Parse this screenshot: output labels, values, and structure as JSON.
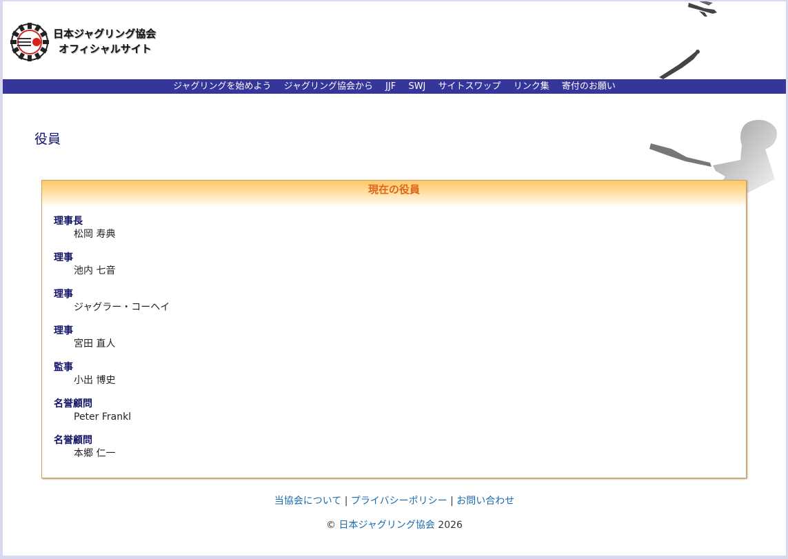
{
  "header": {
    "title_line1": "日本ジャグリング協会",
    "title_line2": "オフィシャルサイト"
  },
  "nav": [
    "ジャグリングを始めよう",
    "ジャグリング協会から",
    "JJF",
    "SWJ",
    "サイトスワップ",
    "リンク集",
    "寄付のお願い"
  ],
  "page": {
    "title": "役員"
  },
  "officers": {
    "heading": "現在の役員",
    "list": [
      {
        "role": "理事長",
        "name": "松岡 寿典"
      },
      {
        "role": "理事",
        "name": "池内 七音"
      },
      {
        "role": "理事",
        "name": "ジャグラー・コーヘイ"
      },
      {
        "role": "理事",
        "name": "宮田 直人"
      },
      {
        "role": "監事",
        "name": "小出 博史"
      },
      {
        "role": "名誉顧問",
        "name": "Peter Frankl"
      },
      {
        "role": "名誉顧問",
        "name": "本郷 仁一"
      }
    ]
  },
  "footer": {
    "link1": "当協会について",
    "link2": "プライバシーポリシー",
    "link3": "お問い合わせ",
    "sep": "|",
    "copyright_symbol": "©",
    "copyright_link": "日本ジャグリング協会",
    "year": "2026"
  },
  "colors": {
    "nav_bg": "#35359a",
    "heading": "#121270",
    "box_heading": "#e0661a",
    "link": "#1a6ab0"
  }
}
